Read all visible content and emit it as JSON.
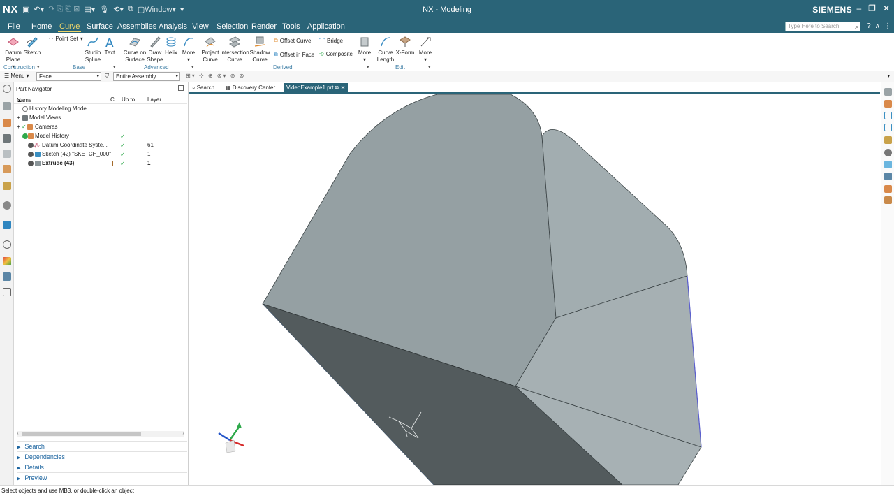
{
  "app": {
    "logo": "NX",
    "title": "NX - Modeling",
    "brand": "SIEMENS",
    "window_menu": "Window"
  },
  "menu_tabs": [
    "File",
    "Home",
    "Curve",
    "Surface",
    "Assemblies",
    "Analysis",
    "View",
    "Selection",
    "Render",
    "Tools",
    "Application"
  ],
  "active_tab": "Curve",
  "search": {
    "placeholder": "Type Here to Search"
  },
  "ribbon": {
    "construction": {
      "datum_plane": [
        "Datum",
        "Plane"
      ],
      "sketch": "Sketch",
      "label": "Construction"
    },
    "base": {
      "point_set": "Point Set",
      "studio_spline": [
        "Studio",
        "Spline"
      ],
      "text": "Text",
      "label": "Base"
    },
    "advanced": {
      "curve_on_surface": [
        "Curve on",
        "Surface"
      ],
      "draw_shape": [
        "Draw",
        "Shape"
      ],
      "helix": "Helix",
      "more": "More",
      "label": "Advanced"
    },
    "derived": {
      "project_curve": [
        "Project",
        "Curve"
      ],
      "intersection_curve": [
        "Intersection",
        "Curve"
      ],
      "shadow_curve": [
        "Shadow",
        "Curve"
      ],
      "offset_curve": "Offset Curve",
      "offset_in_face": "Offset in Face",
      "bridge": "Bridge",
      "composite": "Composite",
      "more": "More",
      "label": "Derived"
    },
    "edit": {
      "curve_length": [
        "Curve",
        "Length"
      ],
      "x_form": "X-Form",
      "more": "More",
      "label": "Edit"
    }
  },
  "selection_bar": {
    "menu": "Menu",
    "filter": "Face",
    "scope": "Entire Assembly"
  },
  "navigator": {
    "title": "Part Navigator",
    "columns": {
      "name": "Name",
      "c": "C...",
      "up_to": "Up to ...",
      "layer": "Layer"
    },
    "rows": [
      {
        "name": "History Modeling Mode",
        "check": "",
        "layer": "",
        "bold": false
      },
      {
        "name": "Model Views",
        "check": "",
        "layer": "",
        "bold": false
      },
      {
        "name": "Cameras",
        "check": "",
        "layer": "",
        "bold": false
      },
      {
        "name": "Model History",
        "check": "✓",
        "layer": "",
        "bold": false
      },
      {
        "name": "Datum Coordinate Syste...",
        "check": "✓",
        "layer": "61",
        "bold": false
      },
      {
        "name": "Sketch (42) \"SKETCH_000\"",
        "check": "✓",
        "layer": "1",
        "bold": false
      },
      {
        "name": "Extrude (43)",
        "check": "✓",
        "layer": "1",
        "bold": true
      }
    ],
    "panels": [
      "Search",
      "Dependencies",
      "Details",
      "Preview"
    ]
  },
  "doc_tabs": {
    "search": "Search",
    "discovery": "Discovery Center",
    "active": "VideoExample1.prt"
  },
  "status": "Select objects and use MB3, or double-click an object",
  "colors": {
    "title_bar": "#2a6478",
    "active_tab": "#f0d66a",
    "face_top": "#95a0a3",
    "face_right": "#a6b0b3",
    "face_dark": "#535b5d",
    "check": "#2fa94b"
  }
}
